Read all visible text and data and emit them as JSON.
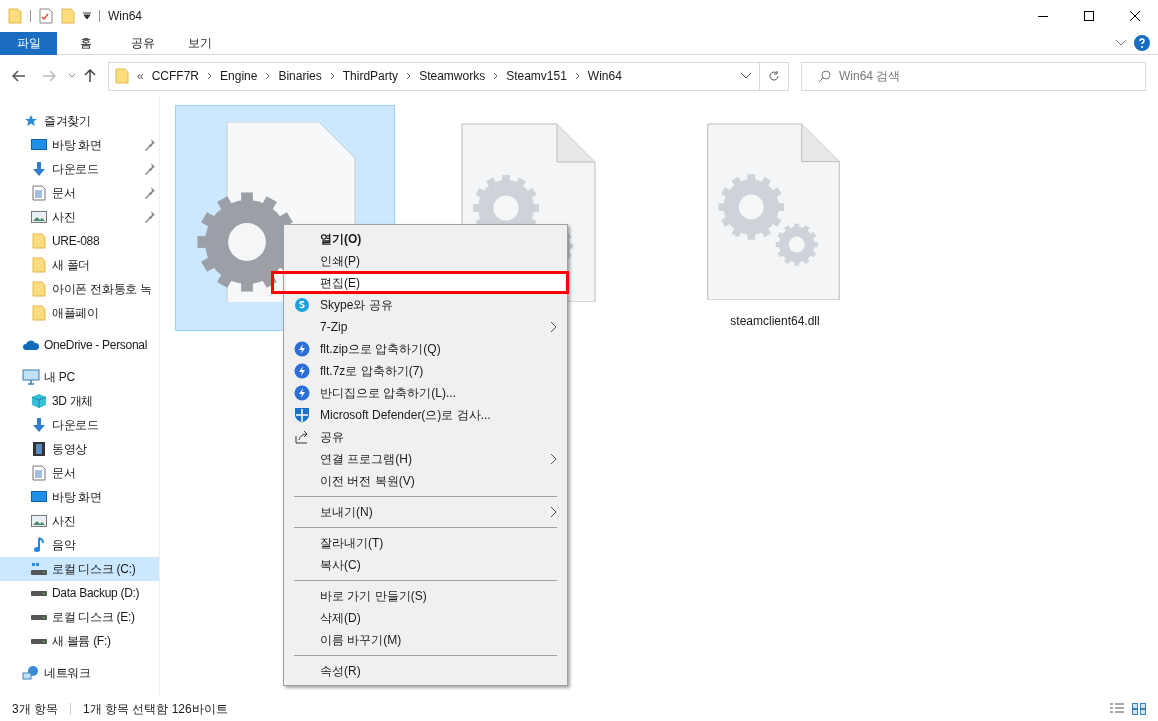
{
  "window": {
    "title": "Win64"
  },
  "ribbon_tabs": [
    {
      "label": "파일",
      "selected": true
    },
    {
      "label": "홈",
      "selected": false
    },
    {
      "label": "공유",
      "selected": false
    },
    {
      "label": "보기",
      "selected": false
    }
  ],
  "breadcrumb": [
    "CCFF7R",
    "Engine",
    "Binaries",
    "ThirdParty",
    "Steamworks",
    "Steamv151",
    "Win64"
  ],
  "breadcrumb_overflow": "«",
  "search": {
    "placeholder": "Win64 검색"
  },
  "nav": [
    {
      "label": "즐겨찾기",
      "kind": "star",
      "selected": false,
      "children": [
        {
          "label": "바탕 화면",
          "kind": "desktop",
          "pinned": true,
          "selected": false
        },
        {
          "label": "다운로드",
          "kind": "download",
          "pinned": true,
          "selected": false
        },
        {
          "label": "문서",
          "kind": "document",
          "pinned": true,
          "selected": false
        },
        {
          "label": "사진",
          "kind": "pictures",
          "pinned": true,
          "selected": false
        },
        {
          "label": "URE-088",
          "kind": "folder",
          "pinned": false,
          "selected": false
        },
        {
          "label": "새 폴더",
          "kind": "folder",
          "pinned": false,
          "selected": false
        },
        {
          "label": "아이폰 전화통호 녹",
          "kind": "folder",
          "pinned": false,
          "selected": false
        },
        {
          "label": "애플페이",
          "kind": "folder",
          "pinned": false,
          "selected": false
        }
      ]
    },
    {
      "label": "OneDrive - Personal",
      "kind": "cloud",
      "selected": false
    },
    {
      "label": "내 PC",
      "kind": "pc",
      "selected": false,
      "children": [
        {
          "label": "3D 개체",
          "kind": "cube",
          "pinned": false,
          "selected": false
        },
        {
          "label": "다운로드",
          "kind": "download",
          "pinned": false,
          "selected": false
        },
        {
          "label": "동영상",
          "kind": "video",
          "pinned": false,
          "selected": false
        },
        {
          "label": "문서",
          "kind": "document",
          "pinned": false,
          "selected": false
        },
        {
          "label": "바탕 화면",
          "kind": "desktop",
          "pinned": false,
          "selected": false
        },
        {
          "label": "사진",
          "kind": "pictures",
          "pinned": false,
          "selected": false
        },
        {
          "label": "음악",
          "kind": "music",
          "pinned": false,
          "selected": false
        },
        {
          "label": "로컬 디스크 (C:)",
          "kind": "system-drive",
          "pinned": false,
          "selected": true
        },
        {
          "label": "Data Backup (D:)",
          "kind": "drive",
          "pinned": false,
          "selected": false
        },
        {
          "label": "로컬 디스크 (E:)",
          "kind": "drive",
          "pinned": false,
          "selected": false
        },
        {
          "label": "새 볼륨 (F:)",
          "kind": "drive",
          "pinned": false,
          "selected": false
        }
      ]
    },
    {
      "label": "네트워크",
      "kind": "network",
      "selected": false
    }
  ],
  "files": [
    {
      "kind": "single-gear",
      "selected": true
    },
    {
      "kind": "double-gear",
      "selected": false
    },
    {
      "kind": "double-gear",
      "label": "steamclient64.dll",
      "selected": false
    }
  ],
  "context_menu": [
    {
      "kind": "item",
      "label": "열기(O)",
      "bold": true,
      "hovered": false
    },
    {
      "kind": "item",
      "label": "인쇄(P)",
      "hovered": false
    },
    {
      "kind": "item",
      "label": "편집(E)",
      "hovered": true
    },
    {
      "kind": "skype-item",
      "label": "Skype와 공유",
      "hovered": false
    },
    {
      "kind": "item",
      "label": "7-Zip",
      "submenu": true,
      "hovered": false
    },
    {
      "kind": "zip-item",
      "label": "flt.zip으로 압축하기(Q)",
      "hovered": false
    },
    {
      "kind": "zip-item",
      "label": "flt.7z로 압축하기(7)",
      "hovered": false
    },
    {
      "kind": "zip-item",
      "label": "반디집으로 압축하기(L)...",
      "hovered": false
    },
    {
      "kind": "defender-item",
      "label": "Microsoft Defender(으)로 검사...",
      "hovered": false
    },
    {
      "kind": "share-item",
      "label": "공유",
      "hovered": false
    },
    {
      "kind": "item",
      "label": "연결 프로그램(H)",
      "submenu": true,
      "hovered": false
    },
    {
      "kind": "item",
      "label": "이전 버전 복원(V)",
      "hovered": false
    },
    {
      "kind": "separator"
    },
    {
      "kind": "item",
      "label": "보내기(N)",
      "submenu": true,
      "hovered": false
    },
    {
      "kind": "separator"
    },
    {
      "kind": "item",
      "label": "잘라내기(T)",
      "hovered": false
    },
    {
      "kind": "item",
      "label": "복사(C)",
      "hovered": false
    },
    {
      "kind": "separator"
    },
    {
      "kind": "item",
      "label": "바로 가기 만들기(S)",
      "hovered": false
    },
    {
      "kind": "item",
      "label": "삭제(D)",
      "hovered": false
    },
    {
      "kind": "item",
      "label": "이름 바꾸기(M)",
      "hovered": false
    },
    {
      "kind": "separator"
    },
    {
      "kind": "item",
      "label": "속성(R)",
      "hovered": false
    }
  ],
  "status_bar": {
    "item_count": "3개 항목",
    "selection": "1개 항목 선택함 126바이트"
  }
}
